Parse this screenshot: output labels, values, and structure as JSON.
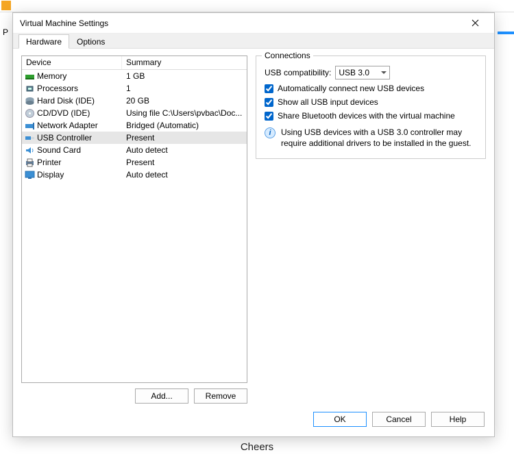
{
  "dialog": {
    "title": "Virtual Machine Settings",
    "tabs": [
      "Hardware",
      "Options"
    ],
    "active_tab": 0
  },
  "device_list": {
    "headers": [
      "Device",
      "Summary"
    ],
    "rows": [
      {
        "icon": "memory",
        "name": "Memory",
        "summary": "1 GB"
      },
      {
        "icon": "cpu",
        "name": "Processors",
        "summary": "1"
      },
      {
        "icon": "hdd",
        "name": "Hard Disk (IDE)",
        "summary": "20 GB"
      },
      {
        "icon": "cd",
        "name": "CD/DVD (IDE)",
        "summary": "Using file C:\\Users\\pvbac\\Doc..."
      },
      {
        "icon": "net",
        "name": "Network Adapter",
        "summary": "Bridged (Automatic)"
      },
      {
        "icon": "usb",
        "name": "USB Controller",
        "summary": "Present",
        "selected": true
      },
      {
        "icon": "sound",
        "name": "Sound Card",
        "summary": "Auto detect"
      },
      {
        "icon": "printer",
        "name": "Printer",
        "summary": "Present"
      },
      {
        "icon": "display",
        "name": "Display",
        "summary": "Auto detect"
      }
    ],
    "add_button": "Add...",
    "remove_button": "Remove"
  },
  "connections": {
    "group_title": "Connections",
    "compat_label": "USB compatibility:",
    "compat_value": "USB 3.0",
    "chk_auto": "Automatically connect new USB devices",
    "chk_show": "Show all USB input devices",
    "chk_bt": "Share Bluetooth devices with the virtual machine",
    "info": "Using USB devices with a USB 3.0 controller may require additional drivers to be installed in the guest."
  },
  "footer": {
    "ok": "OK",
    "cancel": "Cancel",
    "help": "Help"
  },
  "background": {
    "cheers": "Cheers"
  },
  "icons": {
    "memory_color": "#2e9e2e",
    "hdd_color": "#8aa0b0",
    "cd_color": "#c0cdd8",
    "net_color": "#3b8fd4",
    "usb_color": "#3b8fd4",
    "sound_color": "#3b8fd4",
    "printer_color": "#6080a0",
    "display_color": "#3b8fd4",
    "cpu_color": "#5a7a8a"
  }
}
